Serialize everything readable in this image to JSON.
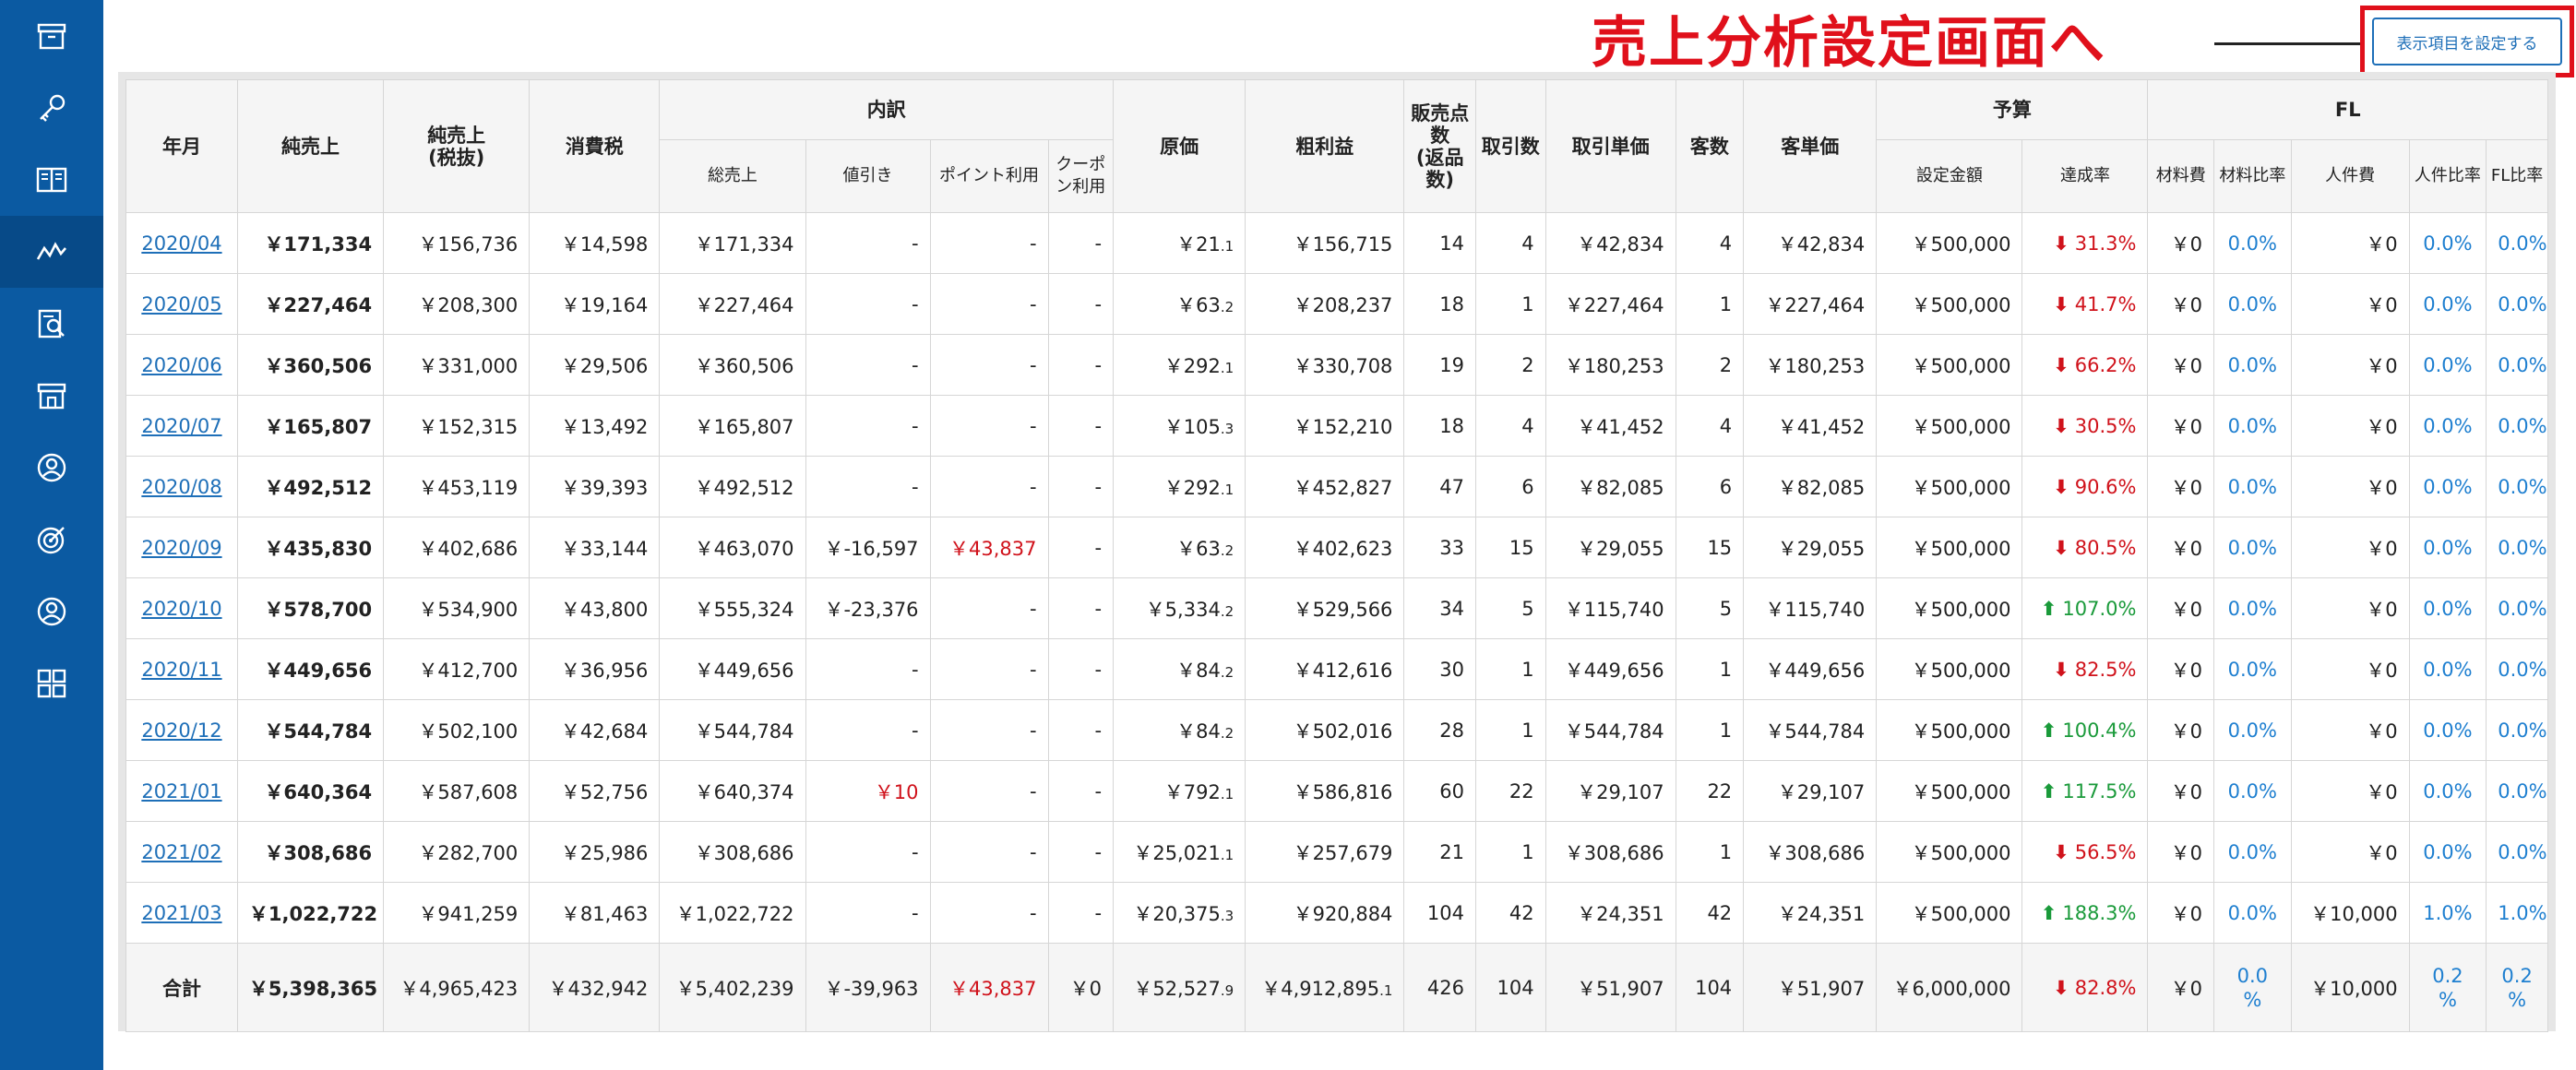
{
  "sidebar": {
    "items": [
      {
        "icon": "archive-icon",
        "active": false
      },
      {
        "icon": "key-icon",
        "active": false
      },
      {
        "icon": "book-icon",
        "active": false
      },
      {
        "icon": "chart-line-icon",
        "active": true
      },
      {
        "icon": "report-search-icon",
        "active": false
      },
      {
        "icon": "store-icon",
        "active": false
      },
      {
        "icon": "customer-icon",
        "active": false
      },
      {
        "icon": "target-icon",
        "active": false
      },
      {
        "icon": "user-icon",
        "active": false
      },
      {
        "icon": "grid-icon",
        "active": false
      }
    ]
  },
  "callout": {
    "text": "売上分析設定画面へ",
    "color": "#e0101b"
  },
  "settings_button": {
    "label": "表示項目を設定する"
  },
  "table": {
    "headers": {
      "year_month": "年月",
      "net_sales": "純売上",
      "net_sales_ex_tax": "純売上\n(税抜)",
      "consumption_tax": "消費税",
      "breakdown": "内訳",
      "breakdown_sub": [
        "総売上",
        "値引き",
        "ポイント利用",
        "クーポ\nン利用"
      ],
      "cost": "原価",
      "gross_profit": "粗利益",
      "units_sold": "販売点\n数\n(返品\n数)",
      "transactions": "取引数",
      "transaction_unit_price": "取引単価",
      "customers": "客数",
      "customer_unit_price": "客単価",
      "budget": "予算",
      "budget_sub": [
        "設定金額",
        "達成率"
      ],
      "fl": "FL",
      "fl_sub": [
        "材料費",
        "材料比率",
        "人件費",
        "人件比率",
        "FL比率"
      ]
    },
    "rows": [
      {
        "ym": "2020/04",
        "net": "￥171,334",
        "net_ex": "￥156,736",
        "tax": "￥14,598",
        "gross": "￥171,334",
        "discount": "-",
        "points": "-",
        "coupon": "-",
        "cost_int": "￥21",
        "cost_dec": ".1",
        "profit": "￥156,715",
        "units": "14",
        "trans": "4",
        "trans_price": "￥42,834",
        "cust": "4",
        "cust_price": "￥42,834",
        "budget": "￥500,000",
        "rate": "31.3%",
        "dir": "down",
        "mat": "￥0",
        "mat_ratio": "0.0%",
        "labor": "￥0",
        "labor_ratio": "0.0%",
        "fl_ratio": "0.0%"
      },
      {
        "ym": "2020/05",
        "net": "￥227,464",
        "net_ex": "￥208,300",
        "tax": "￥19,164",
        "gross": "￥227,464",
        "discount": "-",
        "points": "-",
        "coupon": "-",
        "cost_int": "￥63",
        "cost_dec": ".2",
        "profit": "￥208,237",
        "units": "18",
        "trans": "1",
        "trans_price": "￥227,464",
        "cust": "1",
        "cust_price": "￥227,464",
        "budget": "￥500,000",
        "rate": "41.7%",
        "dir": "down",
        "mat": "￥0",
        "mat_ratio": "0.0%",
        "labor": "￥0",
        "labor_ratio": "0.0%",
        "fl_ratio": "0.0%"
      },
      {
        "ym": "2020/06",
        "net": "￥360,506",
        "net_ex": "￥331,000",
        "tax": "￥29,506",
        "gross": "￥360,506",
        "discount": "-",
        "points": "-",
        "coupon": "-",
        "cost_int": "￥292",
        "cost_dec": ".1",
        "profit": "￥330,708",
        "units": "19",
        "trans": "2",
        "trans_price": "￥180,253",
        "cust": "2",
        "cust_price": "￥180,253",
        "budget": "￥500,000",
        "rate": "66.2%",
        "dir": "down",
        "mat": "￥0",
        "mat_ratio": "0.0%",
        "labor": "￥0",
        "labor_ratio": "0.0%",
        "fl_ratio": "0.0%"
      },
      {
        "ym": "2020/07",
        "net": "￥165,807",
        "net_ex": "￥152,315",
        "tax": "￥13,492",
        "gross": "￥165,807",
        "discount": "-",
        "points": "-",
        "coupon": "-",
        "cost_int": "￥105",
        "cost_dec": ".3",
        "profit": "￥152,210",
        "units": "18",
        "trans": "4",
        "trans_price": "￥41,452",
        "cust": "4",
        "cust_price": "￥41,452",
        "budget": "￥500,000",
        "rate": "30.5%",
        "dir": "down",
        "mat": "￥0",
        "mat_ratio": "0.0%",
        "labor": "￥0",
        "labor_ratio": "0.0%",
        "fl_ratio": "0.0%"
      },
      {
        "ym": "2020/08",
        "net": "￥492,512",
        "net_ex": "￥453,119",
        "tax": "￥39,393",
        "gross": "￥492,512",
        "discount": "-",
        "points": "-",
        "coupon": "-",
        "cost_int": "￥292",
        "cost_dec": ".1",
        "profit": "￥452,827",
        "units": "47",
        "trans": "6",
        "trans_price": "￥82,085",
        "cust": "6",
        "cust_price": "￥82,085",
        "budget": "￥500,000",
        "rate": "90.6%",
        "dir": "down",
        "mat": "￥0",
        "mat_ratio": "0.0%",
        "labor": "￥0",
        "labor_ratio": "0.0%",
        "fl_ratio": "0.0%"
      },
      {
        "ym": "2020/09",
        "net": "￥435,830",
        "net_ex": "￥402,686",
        "tax": "￥33,144",
        "gross": "￥463,070",
        "discount": "￥-16,597",
        "points": "￥43,837",
        "coupon": "-",
        "cost_int": "￥63",
        "cost_dec": ".2",
        "profit": "￥402,623",
        "units": "33",
        "trans": "15",
        "trans_price": "￥29,055",
        "cust": "15",
        "cust_price": "￥29,055",
        "budget": "￥500,000",
        "rate": "80.5%",
        "dir": "down",
        "mat": "￥0",
        "mat_ratio": "0.0%",
        "labor": "￥0",
        "labor_ratio": "0.0%",
        "fl_ratio": "0.0%",
        "points_red": true
      },
      {
        "ym": "2020/10",
        "net": "￥578,700",
        "net_ex": "￥534,900",
        "tax": "￥43,800",
        "gross": "￥555,324",
        "discount": "￥-23,376",
        "points": "-",
        "coupon": "-",
        "cost_int": "￥5,334",
        "cost_dec": ".2",
        "profit": "￥529,566",
        "units": "34",
        "trans": "5",
        "trans_price": "￥115,740",
        "cust": "5",
        "cust_price": "￥115,740",
        "budget": "￥500,000",
        "rate": "107.0%",
        "dir": "up",
        "mat": "￥0",
        "mat_ratio": "0.0%",
        "labor": "￥0",
        "labor_ratio": "0.0%",
        "fl_ratio": "0.0%"
      },
      {
        "ym": "2020/11",
        "net": "￥449,656",
        "net_ex": "￥412,700",
        "tax": "￥36,956",
        "gross": "￥449,656",
        "discount": "-",
        "points": "-",
        "coupon": "-",
        "cost_int": "￥84",
        "cost_dec": ".2",
        "profit": "￥412,616",
        "units": "30",
        "trans": "1",
        "trans_price": "￥449,656",
        "cust": "1",
        "cust_price": "￥449,656",
        "budget": "￥500,000",
        "rate": "82.5%",
        "dir": "down",
        "mat": "￥0",
        "mat_ratio": "0.0%",
        "labor": "￥0",
        "labor_ratio": "0.0%",
        "fl_ratio": "0.0%"
      },
      {
        "ym": "2020/12",
        "net": "￥544,784",
        "net_ex": "￥502,100",
        "tax": "￥42,684",
        "gross": "￥544,784",
        "discount": "-",
        "points": "-",
        "coupon": "-",
        "cost_int": "￥84",
        "cost_dec": ".2",
        "profit": "￥502,016",
        "units": "28",
        "trans": "1",
        "trans_price": "￥544,784",
        "cust": "1",
        "cust_price": "￥544,784",
        "budget": "￥500,000",
        "rate": "100.4%",
        "dir": "up",
        "mat": "￥0",
        "mat_ratio": "0.0%",
        "labor": "￥0",
        "labor_ratio": "0.0%",
        "fl_ratio": "0.0%"
      },
      {
        "ym": "2021/01",
        "net": "￥640,364",
        "net_ex": "￥587,608",
        "tax": "￥52,756",
        "gross": "￥640,374",
        "discount": "￥10",
        "points": "-",
        "coupon": "-",
        "cost_int": "￥792",
        "cost_dec": ".1",
        "profit": "￥586,816",
        "units": "60",
        "trans": "22",
        "trans_price": "￥29,107",
        "cust": "22",
        "cust_price": "￥29,107",
        "budget": "￥500,000",
        "rate": "117.5%",
        "dir": "up",
        "mat": "￥0",
        "mat_ratio": "0.0%",
        "labor": "￥0",
        "labor_ratio": "0.0%",
        "fl_ratio": "0.0%",
        "discount_red": true
      },
      {
        "ym": "2021/02",
        "net": "￥308,686",
        "net_ex": "￥282,700",
        "tax": "￥25,986",
        "gross": "￥308,686",
        "discount": "-",
        "points": "-",
        "coupon": "-",
        "cost_int": "￥25,021",
        "cost_dec": ".1",
        "profit": "￥257,679",
        "units": "21",
        "trans": "1",
        "trans_price": "￥308,686",
        "cust": "1",
        "cust_price": "￥308,686",
        "budget": "￥500,000",
        "rate": "56.5%",
        "dir": "down",
        "mat": "￥0",
        "mat_ratio": "0.0%",
        "labor": "￥0",
        "labor_ratio": "0.0%",
        "fl_ratio": "0.0%"
      },
      {
        "ym": "2021/03",
        "net": "￥1,022,722",
        "net_ex": "￥941,259",
        "tax": "￥81,463",
        "gross": "￥1,022,722",
        "discount": "-",
        "points": "-",
        "coupon": "-",
        "cost_int": "￥20,375",
        "cost_dec": ".3",
        "profit": "￥920,884",
        "units": "104",
        "trans": "42",
        "trans_price": "￥24,351",
        "cust": "42",
        "cust_price": "￥24,351",
        "budget": "￥500,000",
        "rate": "188.3%",
        "dir": "up",
        "mat": "￥0",
        "mat_ratio": "0.0%",
        "labor": "￥10,000",
        "labor_ratio": "1.0%",
        "fl_ratio": "1.0%"
      }
    ],
    "total": {
      "label": "合計",
      "net": "￥5,398,365",
      "net_ex": "￥4,965,423",
      "tax": "￥432,942",
      "gross": "￥5,402,239",
      "discount": "￥-39,963",
      "points": "￥43,837",
      "coupon": "￥0",
      "cost_int": "￥52,527",
      "cost_dec": ".9",
      "profit_int": "￥4,912,895",
      "profit_dec": ".1",
      "units": "426",
      "trans": "104",
      "trans_price": "￥51,907",
      "cust": "104",
      "cust_price": "￥51,907",
      "budget": "￥6,000,000",
      "rate": "82.8%",
      "dir": "down",
      "mat": "￥0",
      "mat_ratio": "0.0\n%",
      "labor": "￥10,000",
      "labor_ratio": "0.2\n%",
      "fl_ratio": "0.2\n%"
    }
  },
  "colors": {
    "sidebar": "#0b5aa2",
    "sidebar_active": "#074a88",
    "link": "#1e6fb8",
    "red": "#d0121b",
    "green": "#1a9a3a",
    "ratio_blue": "#1e7fd0"
  }
}
